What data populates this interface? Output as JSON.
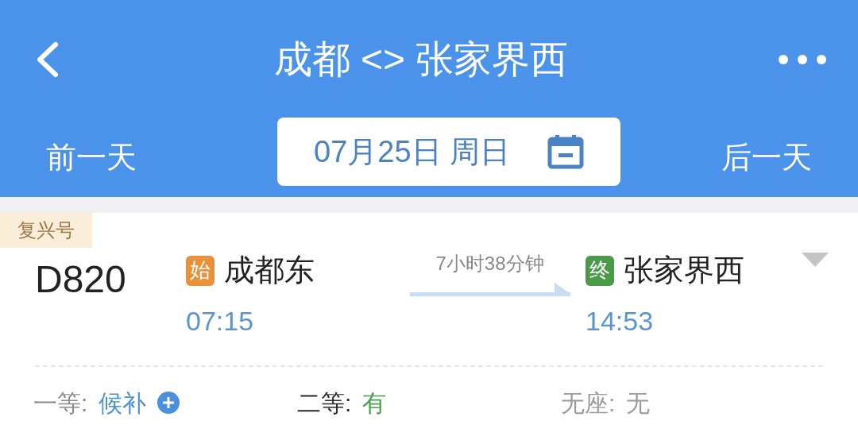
{
  "header": {
    "title": "成都 <> 张家界西"
  },
  "date_bar": {
    "prev": "前一天",
    "date": "07月25日 周日",
    "next": "后一天"
  },
  "train": {
    "badge": "复兴号",
    "number": "D820",
    "from": {
      "mark": "始",
      "station": "成都东",
      "time": "07:15"
    },
    "duration": "7小时38分钟",
    "to": {
      "mark": "终",
      "station": "张家界西",
      "time": "14:53"
    },
    "seats": [
      {
        "label": "一等:",
        "value": "候补",
        "kind": "waitlist"
      },
      {
        "label": "二等:",
        "value": "有",
        "kind": "available"
      },
      {
        "label": "无座:",
        "value": "无",
        "kind": "none"
      }
    ]
  }
}
